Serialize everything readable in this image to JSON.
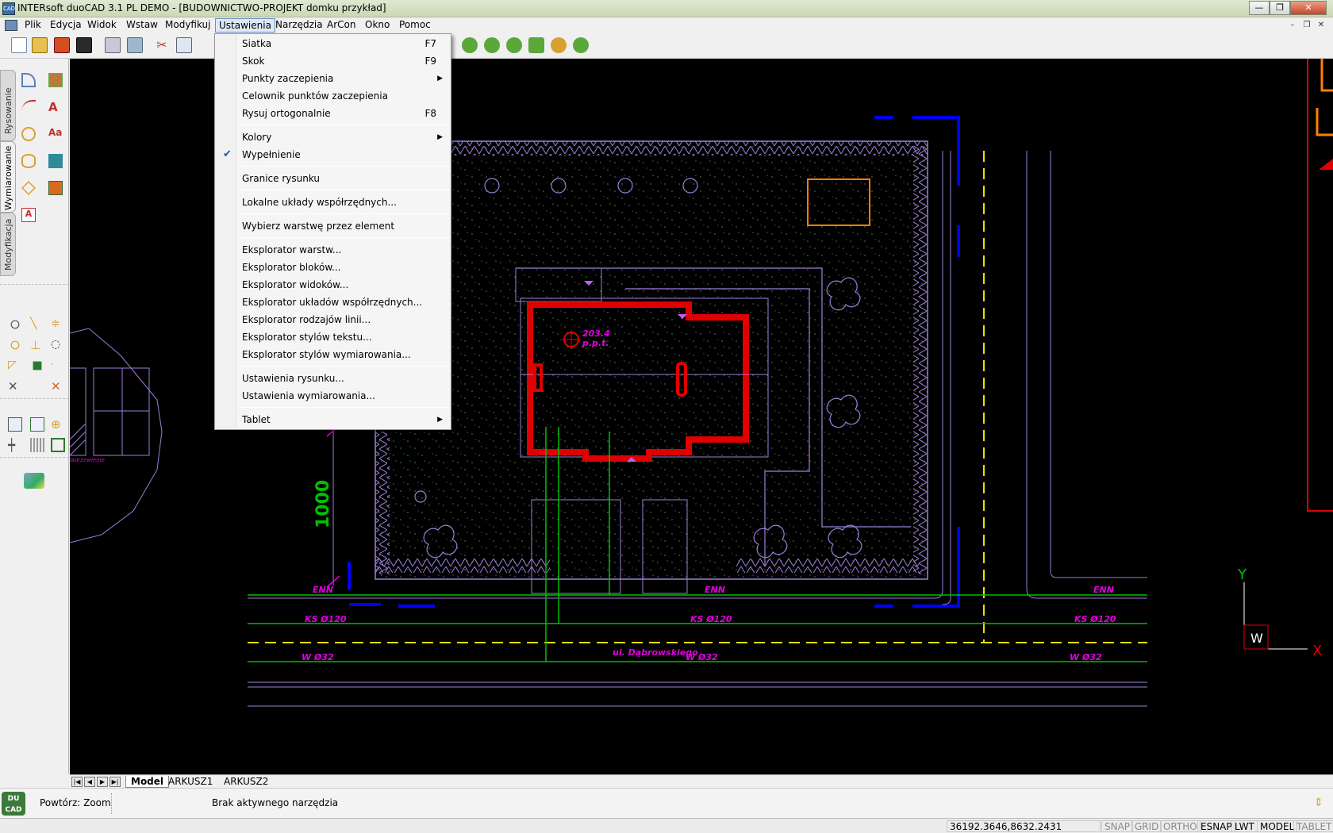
{
  "window": {
    "title": "INTERsoft duoCAD 3.1 PL DEMO - [BUDOWNICTWO-PROJEKT domku przykład]"
  },
  "menubar": [
    "Plik",
    "Edycja",
    "Widok",
    "Wstaw",
    "Modyfikuj",
    "Ustawienia",
    "Narzędzia",
    "ArCon",
    "Okno",
    "Pomoc"
  ],
  "menubar_active": "Ustawienia",
  "dropdown": {
    "items": [
      {
        "label": "Siatka",
        "shortcut": "F7"
      },
      {
        "label": "Skok",
        "shortcut": "F9"
      },
      {
        "label": "Punkty zaczepienia",
        "submenu": true
      },
      {
        "label": "Celownik punktów zaczepienia"
      },
      {
        "label": "Rysuj ortogonalnie",
        "shortcut": "F8"
      },
      {
        "label": "Kolory",
        "submenu": true
      },
      {
        "label": "Wypełnienie",
        "checked": true
      },
      {
        "label": "Granice rysunku"
      },
      {
        "label": "Lokalne układy współrzędnych..."
      },
      {
        "label": "Wybierz warstwę przez element"
      },
      {
        "label": "Eksplorator warstw..."
      },
      {
        "label": "Eksplorator bloków..."
      },
      {
        "label": "Eksplorator widoków..."
      },
      {
        "label": "Eksplorator układów współrzędnych..."
      },
      {
        "label": "Eksplorator rodzajów linii..."
      },
      {
        "label": "Eksplorator stylów tekstu..."
      },
      {
        "label": "Eksplorator stylów wymiarowania..."
      },
      {
        "label": "Ustawienia rysunku..."
      },
      {
        "label": "Ustawienia wymiarowania..."
      },
      {
        "label": "Tablet",
        "submenu": true
      }
    ]
  },
  "left_tabs": [
    "Rysowanie",
    "Wymiarowanie",
    "Modyfikacja"
  ],
  "drawing": {
    "dimension": "1000",
    "elevation": "203.4",
    "elevation_sub": "p.p.t.",
    "labels_enn": [
      "ENN",
      "ENN",
      "ENN"
    ],
    "labels_ks": [
      "KS Ø120",
      "KS Ø120",
      "KS Ø120"
    ],
    "labels_w": [
      "W Ø32",
      "W Ø32",
      "W Ø32"
    ],
    "street": "ul. Dąbrowskiego",
    "tiny_label": "zadrzewienie",
    "ucs_y": "Y",
    "ucs_x": "X",
    "ucs_w": "W"
  },
  "sheet_tabs": [
    "Model",
    "ARKUSZ1",
    "ARKUSZ2"
  ],
  "command": {
    "repeat": "Powtórz: Zoom",
    "status": "Brak aktywnego narzędzia"
  },
  "statusbar": {
    "coords": "36192.3646,8632.2431",
    "toggles": [
      {
        "label": "SNAP",
        "on": false
      },
      {
        "label": "GRID",
        "on": false
      },
      {
        "label": "ORTHO",
        "on": false
      },
      {
        "label": "ESNAP",
        "on": true
      },
      {
        "label": "LWT",
        "on": true
      },
      {
        "label": "MODEL",
        "on": true
      },
      {
        "label": "TABLET",
        "on": false
      }
    ]
  },
  "colors": {
    "lines": "#9b7fd6",
    "house": "#e00000",
    "green": "#00c000",
    "yellow": "#e8e000",
    "blue": "#0000ff",
    "orange": "#ff8000",
    "magenta": "#e000e0",
    "dots": "#3a6a3a"
  }
}
